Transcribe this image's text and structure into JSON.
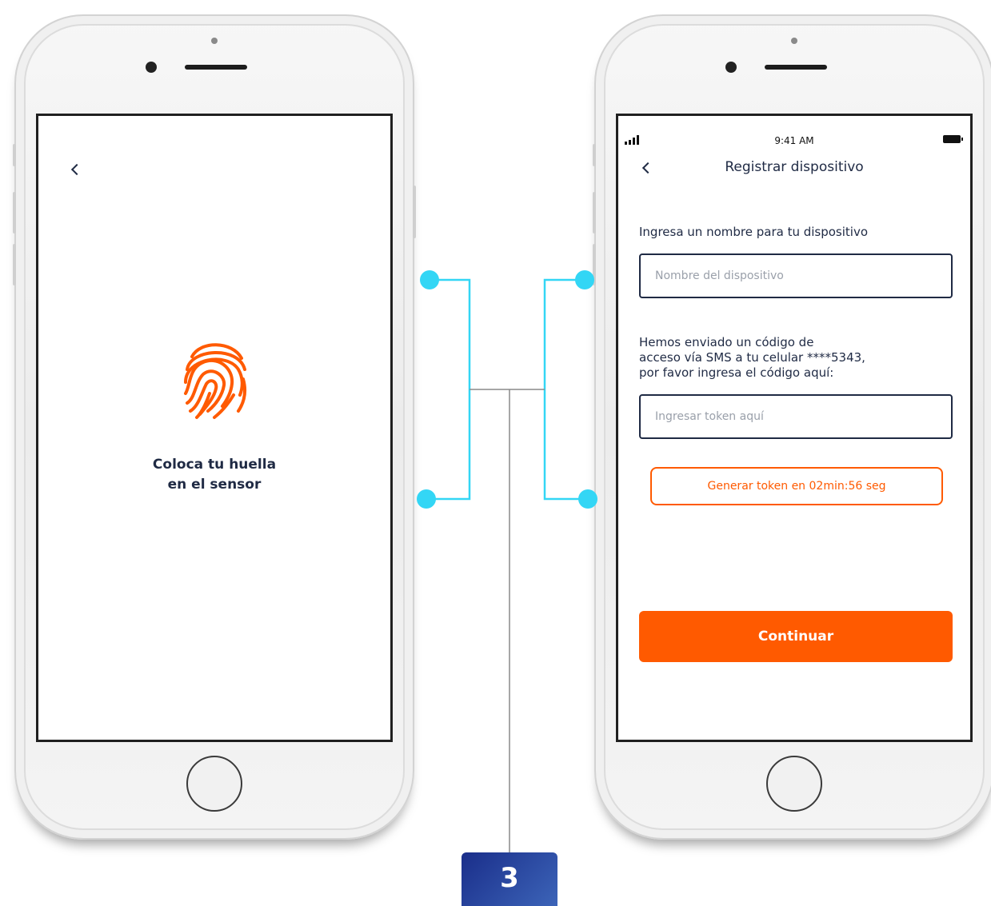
{
  "left_phone": {
    "back_icon": "chevron-left-icon",
    "fingerprint_icon": "fingerprint-icon",
    "fingerprint_color": "#ff5a00",
    "instruction_line1": "Coloca tu huella",
    "instruction_line2": "en el sensor"
  },
  "right_phone": {
    "status_bar": {
      "time": "9:41 AM",
      "signal_icon": "signal-icon",
      "battery_icon": "battery-icon"
    },
    "header": {
      "back_icon": "chevron-left-icon",
      "title": "Registrar dispositivo"
    },
    "device_name": {
      "label": "Ingresa un nombre para tu dispositivo",
      "placeholder": "Nombre del dispositivo",
      "value": ""
    },
    "sms_message": {
      "line1": "Hemos enviado un código de",
      "line2": "acceso vía SMS a tu celular ****5343,",
      "line3": "por favor  ingresa el código aquí:"
    },
    "token": {
      "placeholder": "Ingresar token aquí",
      "value": ""
    },
    "generate_token_button": "Generar token en 02min:56 seg",
    "continue_button": "Continuar"
  },
  "step_badge": "3",
  "colors": {
    "accent": "#ff5a00",
    "text": "#1f2a44",
    "connector": "#33d6f5",
    "badge": "#1a2e8a"
  }
}
